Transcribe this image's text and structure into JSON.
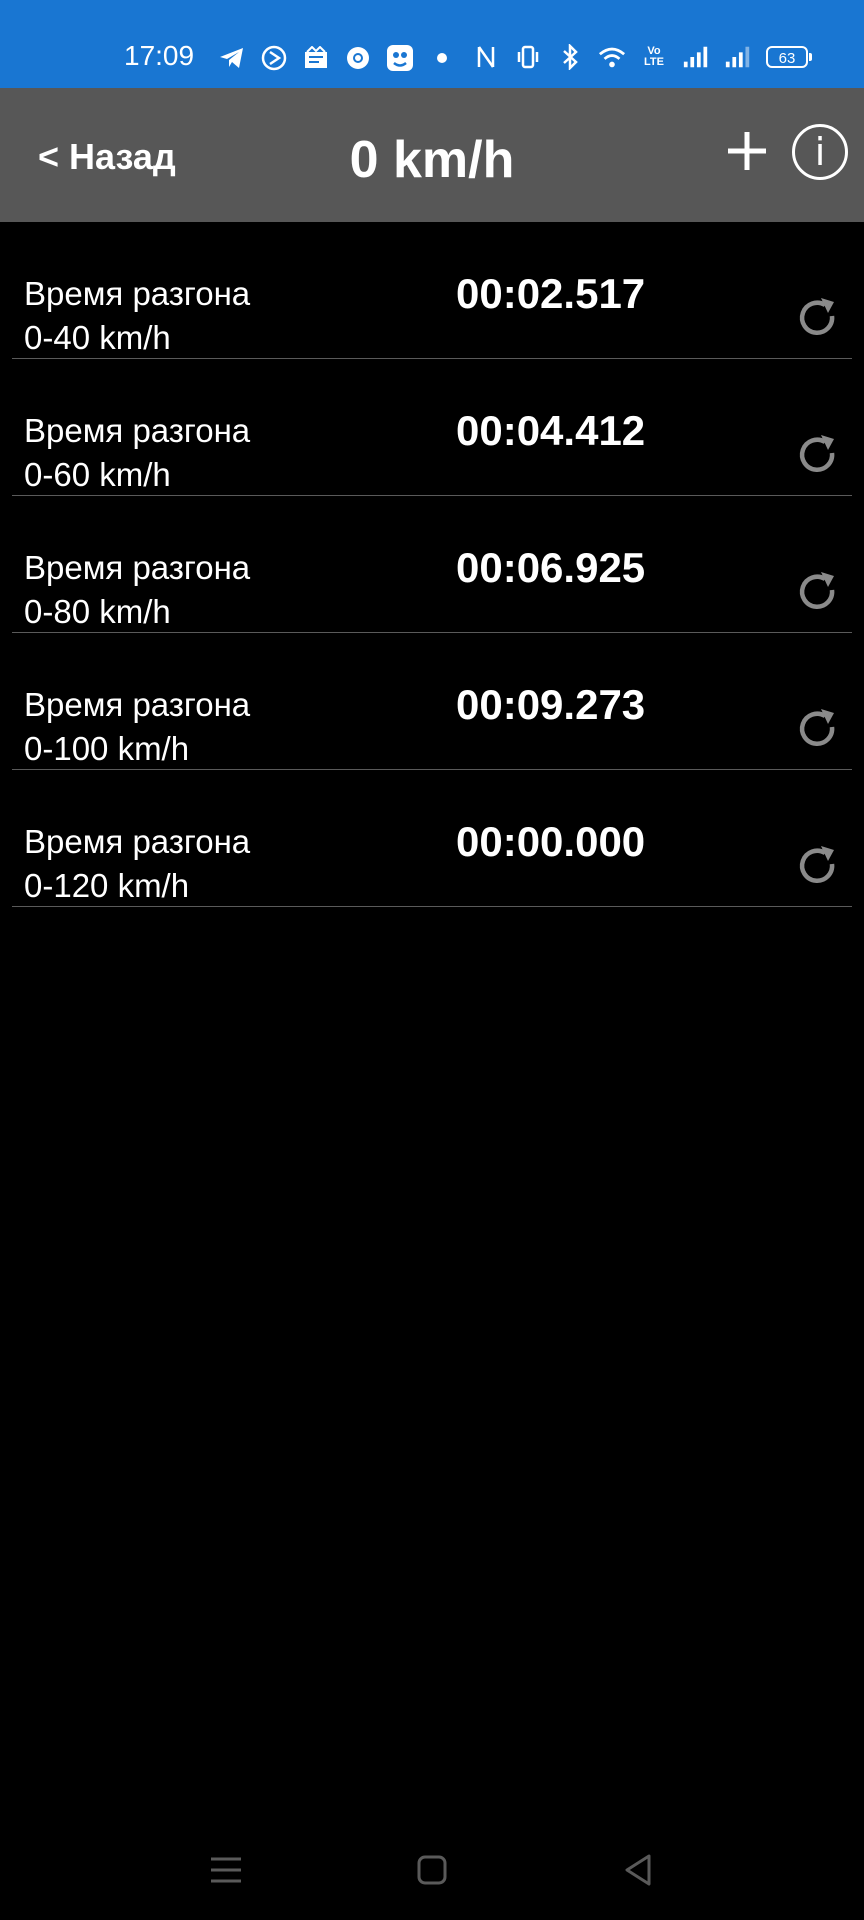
{
  "status_bar": {
    "time": "17:09",
    "battery": "63",
    "volte": "Vo\nLTE",
    "icons": [
      "telegram-icon",
      "navigation-icon",
      "news-icon",
      "chrome-icon",
      "app-icon",
      "dot-icon",
      "nfc-icon",
      "vibrate-icon",
      "bluetooth-icon",
      "wifi-icon",
      "volte-icon",
      "signal-icon",
      "signal-icon",
      "battery-icon"
    ]
  },
  "header": {
    "back_label": "< Назад",
    "title": "0 km/h",
    "add_icon": "plus-icon",
    "info_icon": "info-icon",
    "info_glyph": "i"
  },
  "rows": [
    {
      "label_line1": "Время разгона",
      "label_line2": "0-40 km/h",
      "time": "00:02.517"
    },
    {
      "label_line1": "Время разгона",
      "label_line2": "0-60 km/h",
      "time": "00:04.412"
    },
    {
      "label_line1": "Время разгона",
      "label_line2": "0-80 km/h",
      "time": "00:06.925"
    },
    {
      "label_line1": "Время разгона",
      "label_line2": "0-100 km/h",
      "time": "00:09.273"
    },
    {
      "label_line1": "Время разгона",
      "label_line2": "0-120 km/h",
      "time": "00:00.000"
    }
  ],
  "nav": {
    "items": [
      "menu-icon",
      "home-icon",
      "back-icon"
    ]
  },
  "colors": {
    "status_bar": "#1976d2",
    "header": "#575757",
    "background": "#000000",
    "divider": "#5a5a5a",
    "reset_icon": "#8a8a8a"
  }
}
